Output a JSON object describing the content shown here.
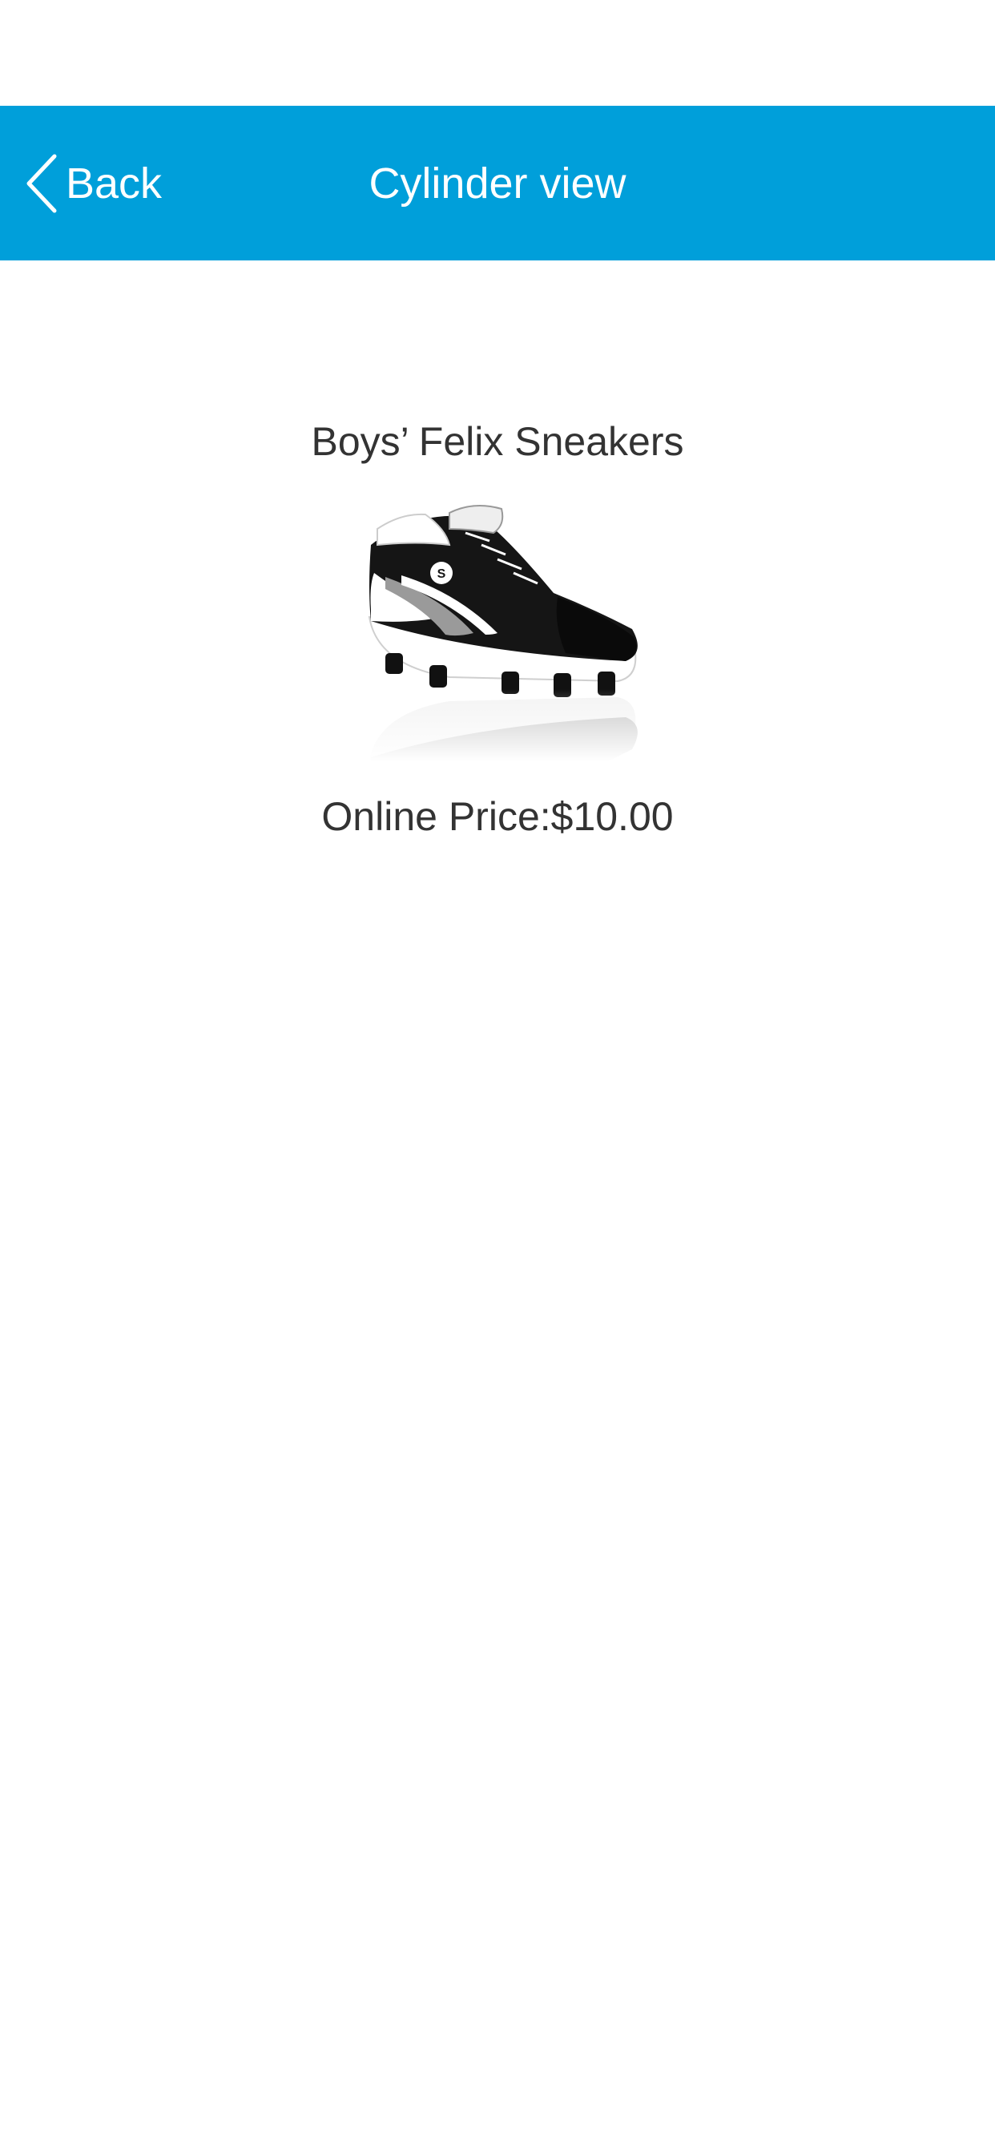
{
  "nav": {
    "back_label": "Back",
    "title": "Cylinder view"
  },
  "product": {
    "name": "Boys’ Felix Sneakers",
    "image_icon": "sneaker-image",
    "price_text": "Online Price:$10.00"
  },
  "colors": {
    "nav_background": "#009fda",
    "nav_text": "#ffffff",
    "body_text": "#333333"
  }
}
